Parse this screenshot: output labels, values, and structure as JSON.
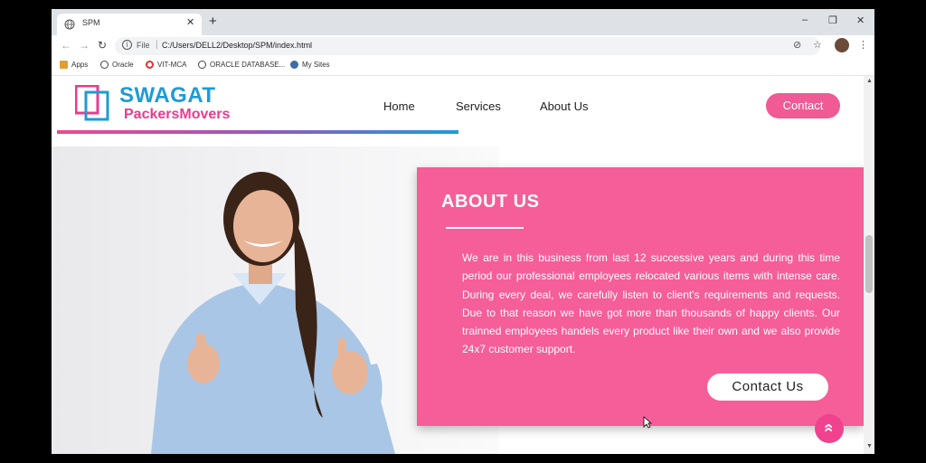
{
  "browser": {
    "tab_title": "SPM",
    "tab_close": "✕",
    "new_tab": "+",
    "window_controls": [
      "–",
      "❐",
      "✕"
    ],
    "scheme_label": "File",
    "url": "C:/Users/DELL2/Desktop/SPM/index.html",
    "bookmarks": [
      "Apps",
      "Oracle",
      "VIT-MCA",
      "ORACLE DATABASE...",
      "My Sites"
    ]
  },
  "header": {
    "logo_title": "SWAGAT",
    "logo_subtitle": "PackersMovers",
    "nav": [
      "Home",
      "Services",
      "About Us"
    ],
    "contact_label": "Contact"
  },
  "about": {
    "title": "ABOUT US",
    "body": "We are in this business from last 12 successive years and during this time period our professional employees relocated various items with intense care. During every deal, we carefully listen to client's requirements and requests. Due to that reason we have got more than thousands of happy clients. Our trainned employees handels every product like their own and we also provide 24x7 customer support.",
    "button_label": "Contact Us"
  },
  "scroll_top_icon": "«",
  "colors": {
    "brand_pink": "#f55e98",
    "brand_blue": "#1e9bd7",
    "button_pink": "#f05a95"
  }
}
